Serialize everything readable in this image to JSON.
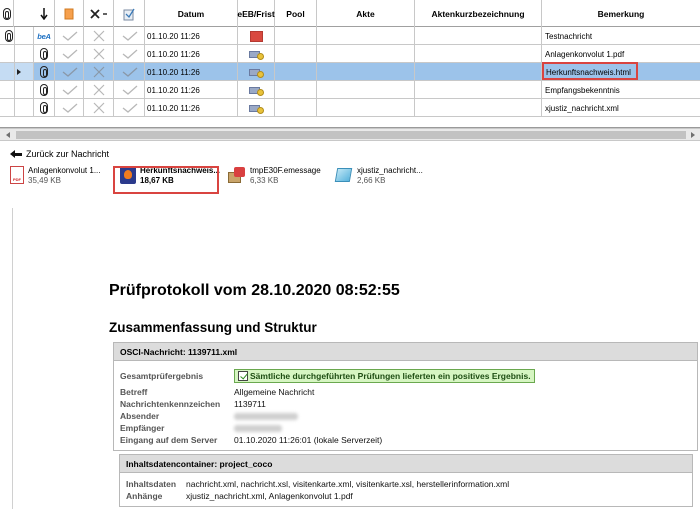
{
  "grid": {
    "headers": {
      "datum": "Datum",
      "frist": "eEB/Frist",
      "pool": "Pool",
      "akte": "Akte",
      "aktenkurz": "Aktenkurzbezeichnung",
      "bemerkung": "Bemerkung"
    },
    "rows": [
      {
        "badge": "beA",
        "date": "01.10.20 11:26",
        "bemerkung": "Testnachricht"
      },
      {
        "date": "01.10.20 11:26",
        "bemerkung": "Anlagenkonvolut 1.pdf"
      },
      {
        "date": "01.10.20 11:26",
        "bemerkung": "Herkunftsnachweis.html"
      },
      {
        "date": "01.10.20 11:26",
        "bemerkung": "Empfangsbekenntnis"
      },
      {
        "date": "01.10.20 11:26",
        "bemerkung": "xjustiz_nachricht.xml"
      }
    ]
  },
  "attachments": {
    "back_label": "Zurück zur Nachricht",
    "files": [
      {
        "name": "Anlagenkonvolut 1...",
        "size": "35,49 KB"
      },
      {
        "name": "Herkunftsnachweis...",
        "size": "18,67 KB"
      },
      {
        "name": "tmpE30F.emessage",
        "size": "6,33 KB"
      },
      {
        "name": "xjustiz_nachricht...",
        "size": "2,66 KB"
      }
    ]
  },
  "doc": {
    "title": "Prüfprotokoll vom 28.10.2020 08:52:55",
    "subtitle": "Zusammenfassung und Struktur",
    "osci": {
      "header": "OSCI-Nachricht: 1139711.xml",
      "gesamt_label": "Gesamtprüfergebnis",
      "gesamt_value": "Sämtliche durchgeführten Prüfungen lieferten ein positives Ergebnis.",
      "betreff_label": "Betreff",
      "betreff_value": "Allgemeine Nachricht",
      "nkz_label": "Nachrichtenkennzeichen",
      "nkz_value": "1139711",
      "absender_label": "Absender",
      "empfaenger_label": "Empfänger",
      "eingang_label": "Eingang auf dem Server",
      "eingang_value": "01.10.2020 11:26:01 (lokale Serverzeit)"
    },
    "container": {
      "header": "Inhaltsdatencontainer: project_coco",
      "inhalt_label": "Inhaltsdaten",
      "inhalt_value": "nachricht.xml, nachricht.xsl, visitenkarte.xml, visitenkarte.xsl, herstellerinformation.xml",
      "anhaenge_label": "Anhänge",
      "anhaenge_value": "xjustiz_nachricht.xml, Anlagenkonvolut 1.pdf"
    }
  },
  "colors": {
    "selection": "#9cc3ea",
    "highlight": "#d94440",
    "frist_red": "#d9493f",
    "ok_green": "#d6f5c2"
  }
}
